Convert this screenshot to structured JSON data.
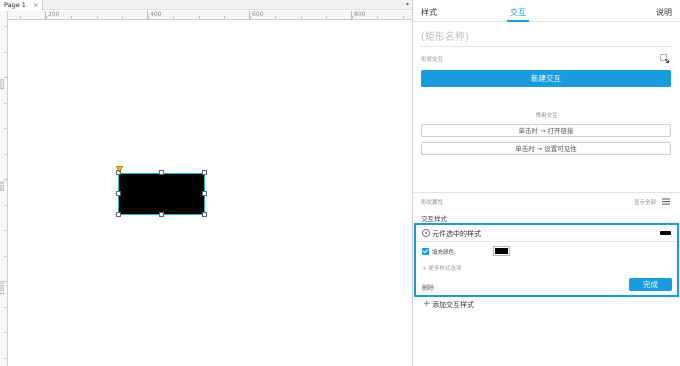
{
  "canvas": {
    "page_tab": "Page 1",
    "tab_close": "×",
    "tabbar_caret": "▾",
    "ruler_top": [
      "200",
      "400",
      "600",
      "800"
    ],
    "ruler_left": [
      "600",
      "800",
      "1000"
    ],
    "shape_color": "#000000",
    "selection_color": "#29b6c6"
  },
  "panel": {
    "tabs": {
      "style": "样式",
      "interactions": "交互",
      "notes": "说明"
    },
    "accent_color": "#1a9be0",
    "shape_name_placeholder": "(矩形名称)",
    "shape_interactions_label": "形状交互",
    "new_interaction": "新建交互",
    "common_interactions_label": "常用交互",
    "common_interactions": [
      "单击时 → 打开链接",
      "单击时 → 设置可见性"
    ],
    "shape_properties_label": "形状属性",
    "show_all": "显示全部",
    "interaction_styles_label": "交互样式",
    "selected_style": {
      "label": "元件选中的样式",
      "swatch_color": "#000000",
      "fill_checked": true,
      "fill_color_label": "填充颜色:",
      "fill_color": "#000000",
      "more_props": "+ 更多样式选项",
      "delete": "删除",
      "done": "完成"
    },
    "add_interaction_style": "添加交互样式",
    "add_icon": "+"
  }
}
